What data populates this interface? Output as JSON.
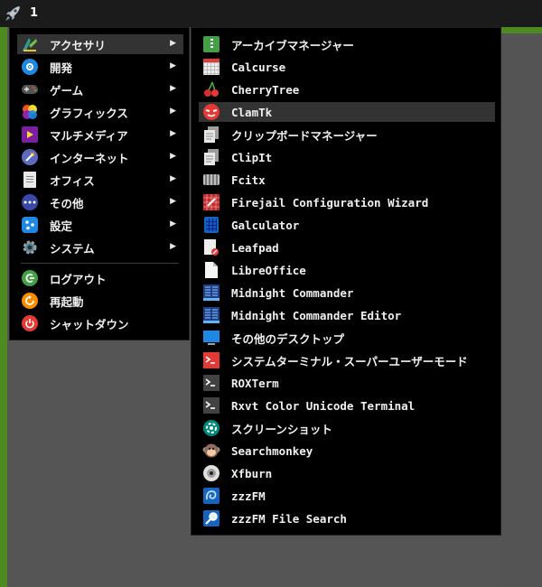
{
  "topbar": {
    "workspace": "1"
  },
  "main_menu": {
    "items": [
      {
        "label": "アクセサリ",
        "icon": "accessories-icon",
        "has_submenu": true
      },
      {
        "label": "開発",
        "icon": "development-icon",
        "has_submenu": true
      },
      {
        "label": "ゲーム",
        "icon": "gamepad-icon",
        "has_submenu": true
      },
      {
        "label": "グラフィックス",
        "icon": "graphics-icon",
        "has_submenu": true
      },
      {
        "label": "マルチメディア",
        "icon": "multimedia-icon",
        "has_submenu": true
      },
      {
        "label": "インターネット",
        "icon": "internet-icon",
        "has_submenu": true
      },
      {
        "label": "オフィス",
        "icon": "office-icon",
        "has_submenu": true
      },
      {
        "label": "その他",
        "icon": "other-icon",
        "has_submenu": true
      },
      {
        "label": "設定",
        "icon": "settings-icon",
        "has_submenu": true
      },
      {
        "label": "システム",
        "icon": "system-gear-icon",
        "has_submenu": true
      }
    ],
    "session": [
      {
        "label": "ログアウト",
        "icon": "logout-icon"
      },
      {
        "label": "再起動",
        "icon": "restart-icon"
      },
      {
        "label": "シャットダウン",
        "icon": "shutdown-icon"
      }
    ],
    "arrow": "▶"
  },
  "sub_menu": {
    "items": [
      {
        "label": "アーカイブマネージャー",
        "icon": "archive-icon"
      },
      {
        "label": "Calcurse",
        "icon": "calendar-icon"
      },
      {
        "label": "CherryTree",
        "icon": "cherry-icon"
      },
      {
        "label": "ClamTk",
        "icon": "clamtk-icon"
      },
      {
        "label": "クリップボードマネージャー",
        "icon": "clipboard-icon"
      },
      {
        "label": "ClipIt",
        "icon": "clipboard-icon"
      },
      {
        "label": "Fcitx",
        "icon": "keyboard-icon"
      },
      {
        "label": "Firejail Configuration Wizard",
        "icon": "firejail-icon"
      },
      {
        "label": "Galculator",
        "icon": "calculator-icon"
      },
      {
        "label": "Leafpad",
        "icon": "text-editor-icon"
      },
      {
        "label": "LibreOffice",
        "icon": "document-icon"
      },
      {
        "label": "Midnight Commander",
        "icon": "file-manager-icon"
      },
      {
        "label": "Midnight Commander Editor",
        "icon": "file-manager-icon"
      },
      {
        "label": "その他のデスクトップ",
        "icon": "desktop-icon"
      },
      {
        "label": "システムターミナル・スーパーユーザーモード",
        "icon": "root-terminal-icon"
      },
      {
        "label": "ROXTerm",
        "icon": "terminal-icon"
      },
      {
        "label": "Rxvt Color Unicode Terminal",
        "icon": "terminal-icon"
      },
      {
        "label": "スクリーンショット",
        "icon": "camera-icon"
      },
      {
        "label": "Searchmonkey",
        "icon": "monkey-icon"
      },
      {
        "label": "Xfburn",
        "icon": "disc-icon"
      },
      {
        "label": "zzzFM",
        "icon": "zzzfm-icon"
      },
      {
        "label": "zzzFM File Search",
        "icon": "zzzfm-search-icon"
      }
    ],
    "highlighted_index": 3
  }
}
